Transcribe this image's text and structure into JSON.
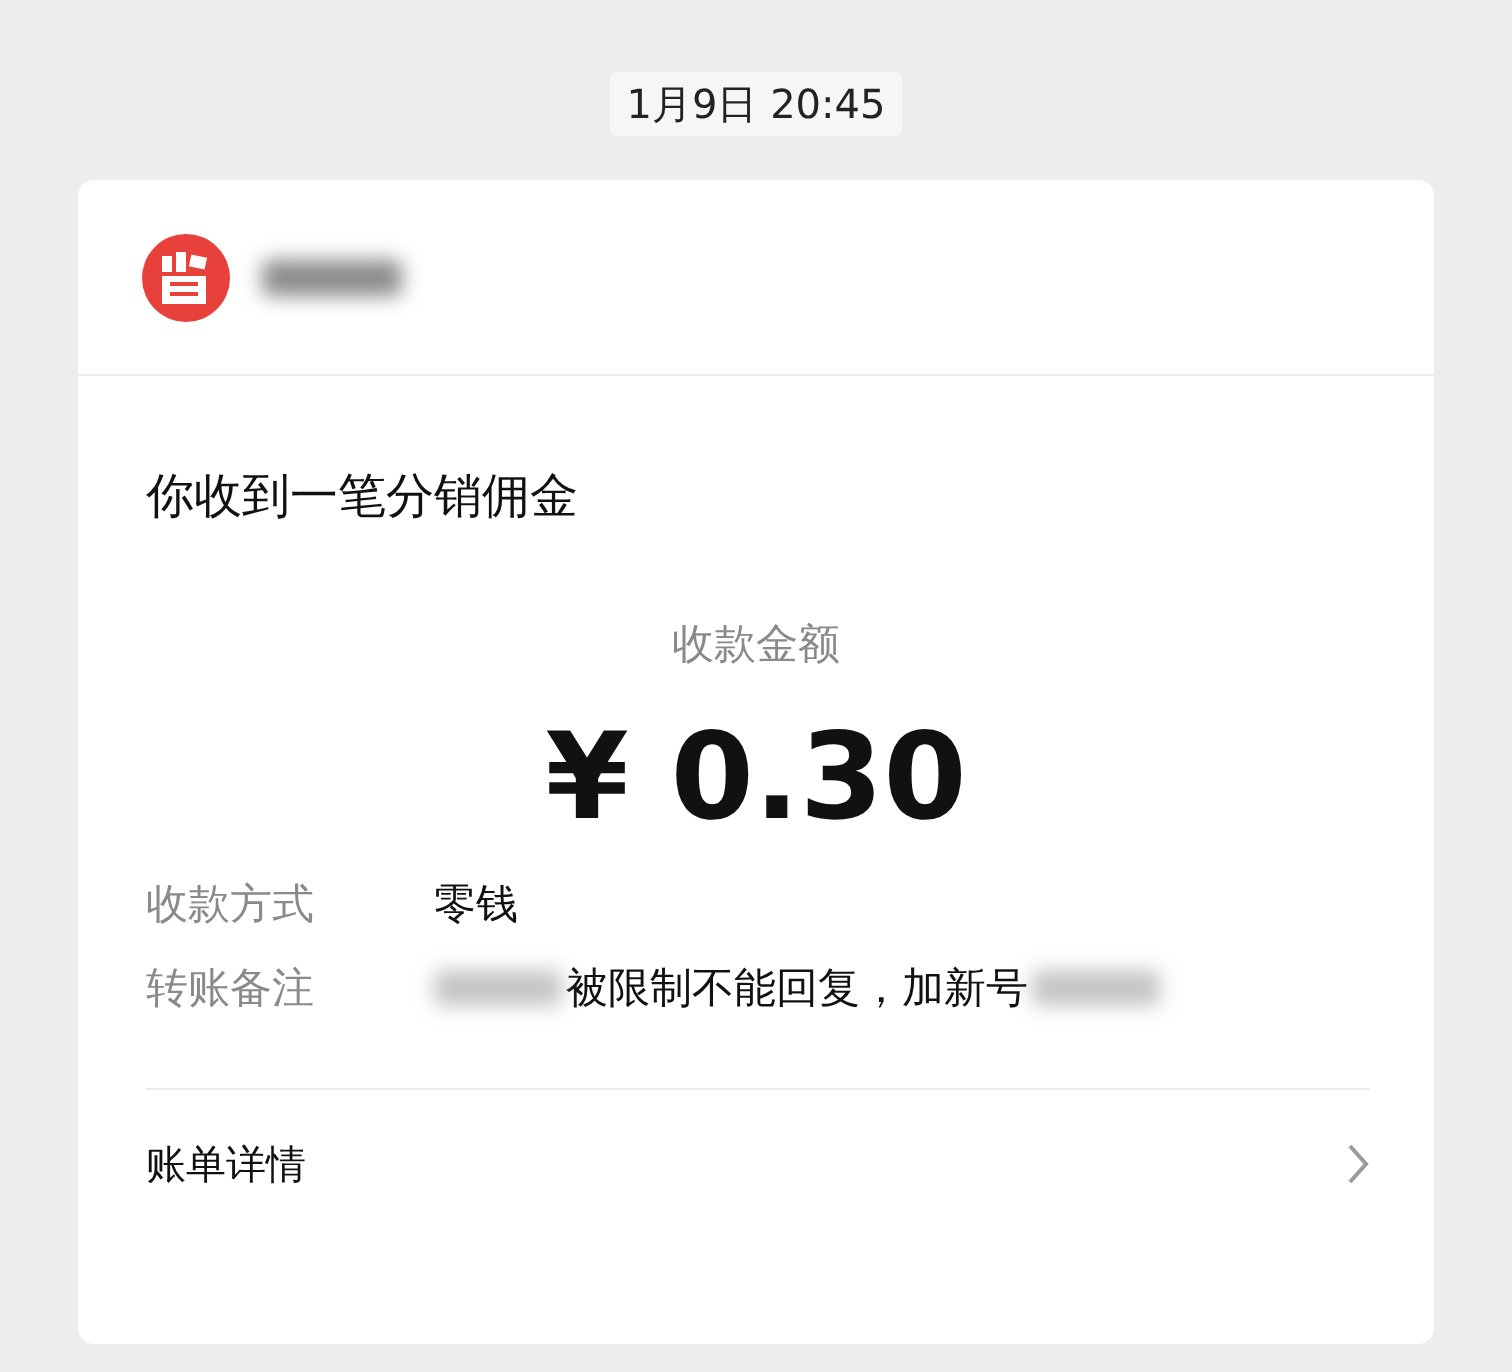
{
  "timestamp": "1月9日 20:45",
  "message": {
    "title": "你收到一笔分销佣金",
    "amount_label": "收款金额",
    "amount": "¥ 0.30",
    "details": [
      {
        "label": "收款方式",
        "parts": [
          {
            "kind": "text",
            "text": "零钱"
          }
        ]
      },
      {
        "label": "转账备注",
        "parts": [
          {
            "kind": "blurred"
          },
          {
            "kind": "text",
            "text": "被限制不能回复，加新号"
          },
          {
            "kind": "blurred"
          }
        ]
      }
    ],
    "footer": "账单详情"
  }
}
